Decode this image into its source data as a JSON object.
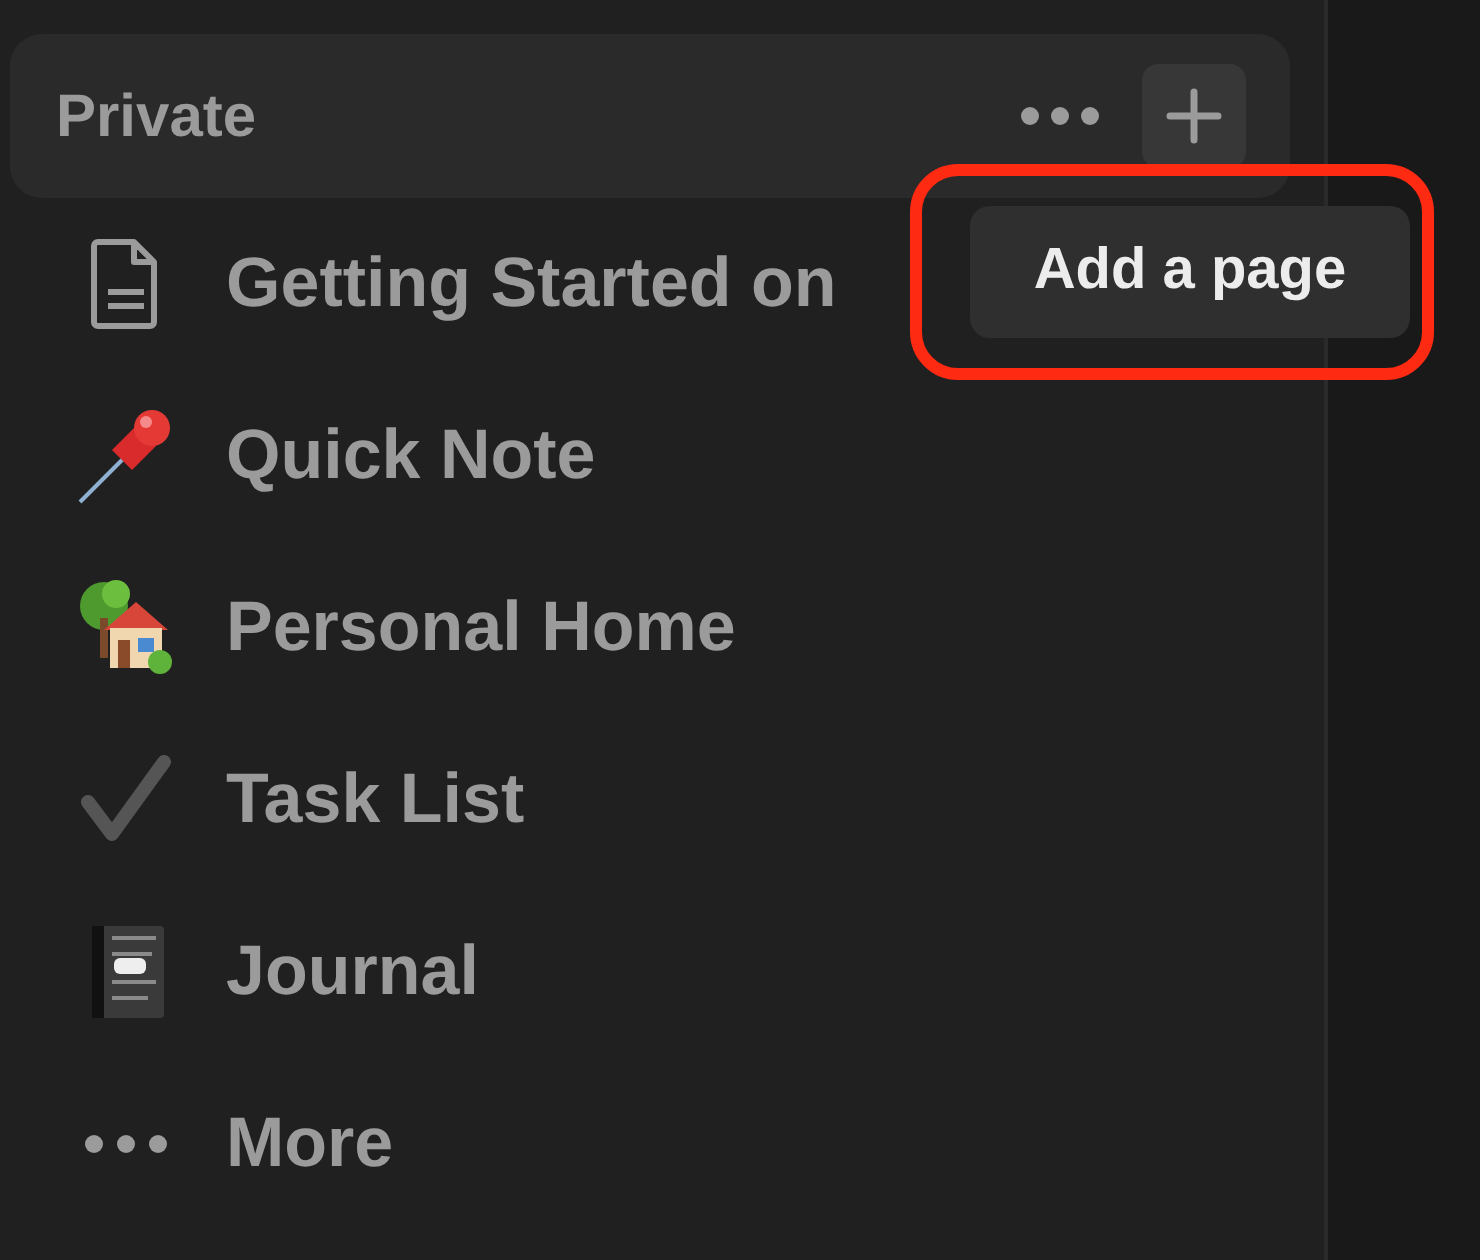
{
  "section": {
    "title": "Private"
  },
  "tooltip": {
    "text": "Add a page"
  },
  "items": [
    {
      "label": "Getting Started on",
      "kind": "page"
    },
    {
      "label": "Quick Note",
      "kind": "pin"
    },
    {
      "label": "Personal Home",
      "kind": "house"
    },
    {
      "label": "Task List",
      "kind": "check"
    },
    {
      "label": "Journal",
      "kind": "notebook"
    },
    {
      "label": "More",
      "kind": "more"
    }
  ]
}
